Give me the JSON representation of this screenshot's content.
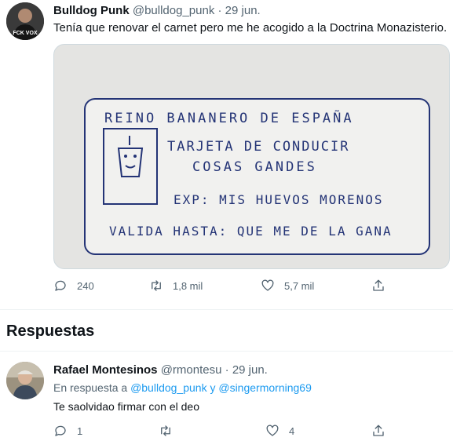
{
  "tweet": {
    "author_name": "Bulldog Punk",
    "handle": "@bulldog_punk",
    "separator": "·",
    "date": "29 jun.",
    "text": "Tenía que renovar el carnet pero me he acogido a la Doctrina Monazisterio.",
    "avatar_badge": "FCK VOX",
    "image": {
      "line1": "REINO BANANERO DE ESPAÑA",
      "line2": "TARJETA DE CONDUCIR",
      "line3": "COSAS GANDES",
      "line4": "EXP: MIS HUEVOS MORENOS",
      "line5": "VALIDA HASTA: QUE ME DE LA GANA"
    },
    "actions": {
      "reply_count": "240",
      "retweet_count": "1,8 mil",
      "like_count": "5,7 mil"
    }
  },
  "replies_section": {
    "title": "Respuestas"
  },
  "reply": {
    "author_name": "Rafael Montesinos",
    "handle": "@rmontesu",
    "separator": "·",
    "date": "29 jun.",
    "reply_prefix": "En respuesta a",
    "mention1": "@bulldog_punk",
    "conjunction": "y",
    "mention2": "@singermorning69",
    "text": "Te saolvidao firmar con el deo",
    "actions": {
      "reply_count": "1",
      "retweet_count": "",
      "like_count": "4"
    }
  },
  "colors": {
    "link": "#1d9bf0",
    "muted": "#536471",
    "text": "#0f1419",
    "ink": "#243476"
  },
  "icons": [
    "reply-icon",
    "retweet-icon",
    "like-icon",
    "share-icon"
  ]
}
